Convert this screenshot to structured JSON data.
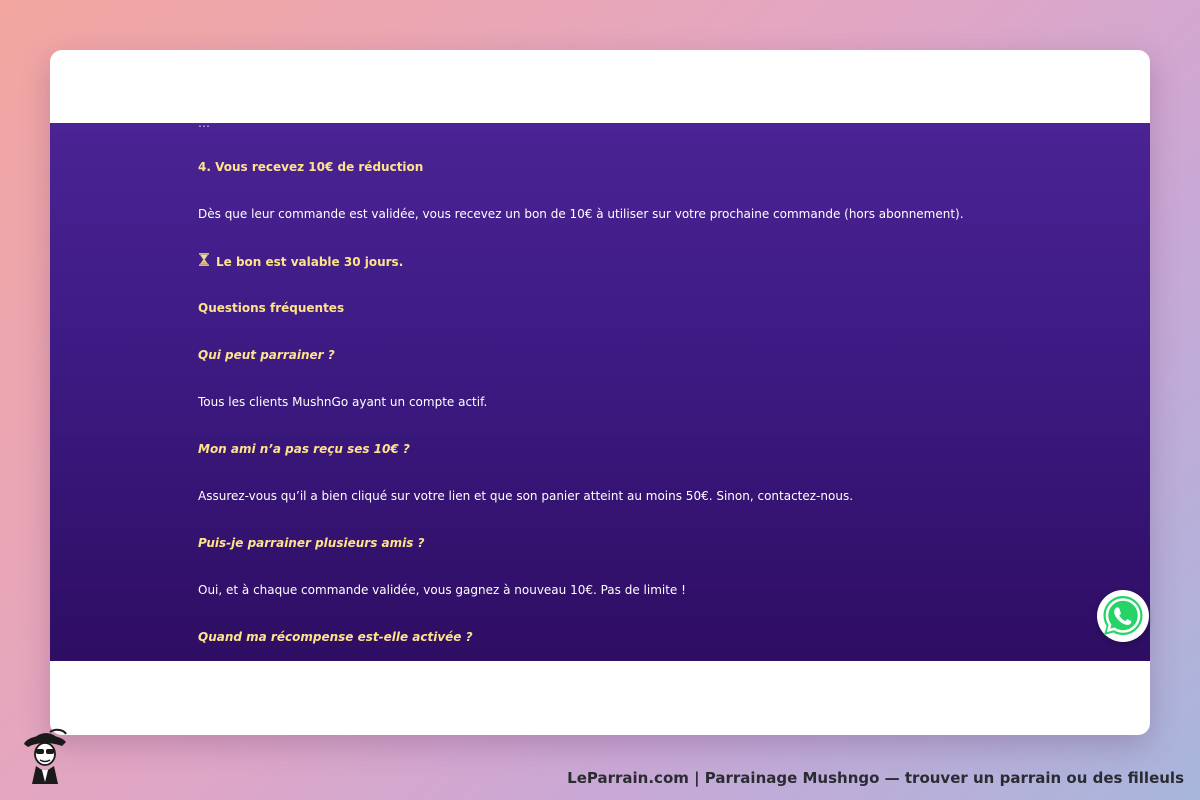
{
  "colors": {
    "accent_yellow": "#ffe38a",
    "content_bg_top": "#4b2394",
    "content_bg_bottom": "#2e0d63",
    "whatsapp_green": "#25d366"
  },
  "article": {
    "cut_off_line": "…",
    "step4_heading": "4. Vous recevez 10€ de réduction",
    "step4_text": "Dès que leur commande est validée, vous recevez un bon de 10€ à utiliser sur votre prochaine commande (hors abonnement).",
    "validity_icon": "hourglass-icon",
    "validity_text": "Le bon est valable 30 jours.",
    "faq_heading": "Questions fréquentes",
    "faq": [
      {
        "question": "Qui peut parrainer ?",
        "answer": "Tous les clients MushnGo ayant un compte actif."
      },
      {
        "question": "Mon ami n’a pas reçu ses 10€ ?",
        "answer": "Assurez-vous qu’il a bien cliqué sur votre lien et que son panier atteint au moins 50€. Sinon, contactez-nous."
      },
      {
        "question": "Puis-je parrainer plusieurs amis ?",
        "answer": "Oui, et à chaque commande validée, vous gagnez à nouveau 10€. Pas de limite !"
      },
      {
        "question": "Quand ma récompense est-elle activée ?"
      }
    ]
  },
  "widgets": {
    "whatsapp_icon": "whatsapp-icon"
  },
  "footer": {
    "logo_icon": "detective-mascot-logo",
    "title": "LeParrain.com | Parrainage Mushngo — trouver un parrain ou des filleuls"
  }
}
